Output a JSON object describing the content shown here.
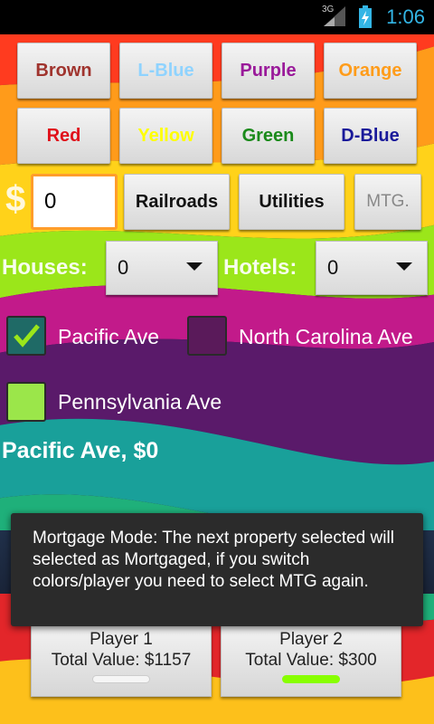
{
  "status_bar": {
    "network": "3G",
    "time": "1:06",
    "icons": [
      "signal-icon",
      "battery-charging-icon"
    ]
  },
  "colors": {
    "accent_orange": "#ff9d2b",
    "status_blue": "#33b5e5",
    "player1_bar": "#ffffff",
    "player2_bar": "#88ff00"
  },
  "property_groups": [
    {
      "label": "Brown",
      "color": "#a0342e"
    },
    {
      "label": "L-Blue",
      "color": "#8fd3ff"
    },
    {
      "label": "Purple",
      "color": "#9a1a9a"
    },
    {
      "label": "Orange",
      "color": "#ff9c1a"
    },
    {
      "label": "Red",
      "color": "#e0101a"
    },
    {
      "label": "Yellow",
      "color": "#ffff00"
    },
    {
      "label": "Green",
      "color": "#1a8a1a"
    },
    {
      "label": "D-Blue",
      "color": "#1a1a9a"
    }
  ],
  "money": {
    "currency_symbol": "$",
    "value": "0"
  },
  "toolbar": {
    "railroads": "Railroads",
    "utilities": "Utilities",
    "mtg": "MTG."
  },
  "houses": {
    "label": "Houses:",
    "value": "0"
  },
  "hotels": {
    "label": "Hotels:",
    "value": "0"
  },
  "properties": [
    {
      "name": "Pacific Ave",
      "checked": true
    },
    {
      "name": "North Carolina Ave",
      "checked": false
    },
    {
      "name": "Pennsylvania Ave",
      "checked": false
    }
  ],
  "summary": "Pacific Ave, $0",
  "toast": "Mortgage Mode: The next property selected will selected as Mortgaged, if you switch colors/player you need to select MTG again.",
  "players": [
    {
      "name": "Player 1",
      "total": "Total Value: $1157"
    },
    {
      "name": "Player 2",
      "total": "Total Value: $300"
    }
  ]
}
